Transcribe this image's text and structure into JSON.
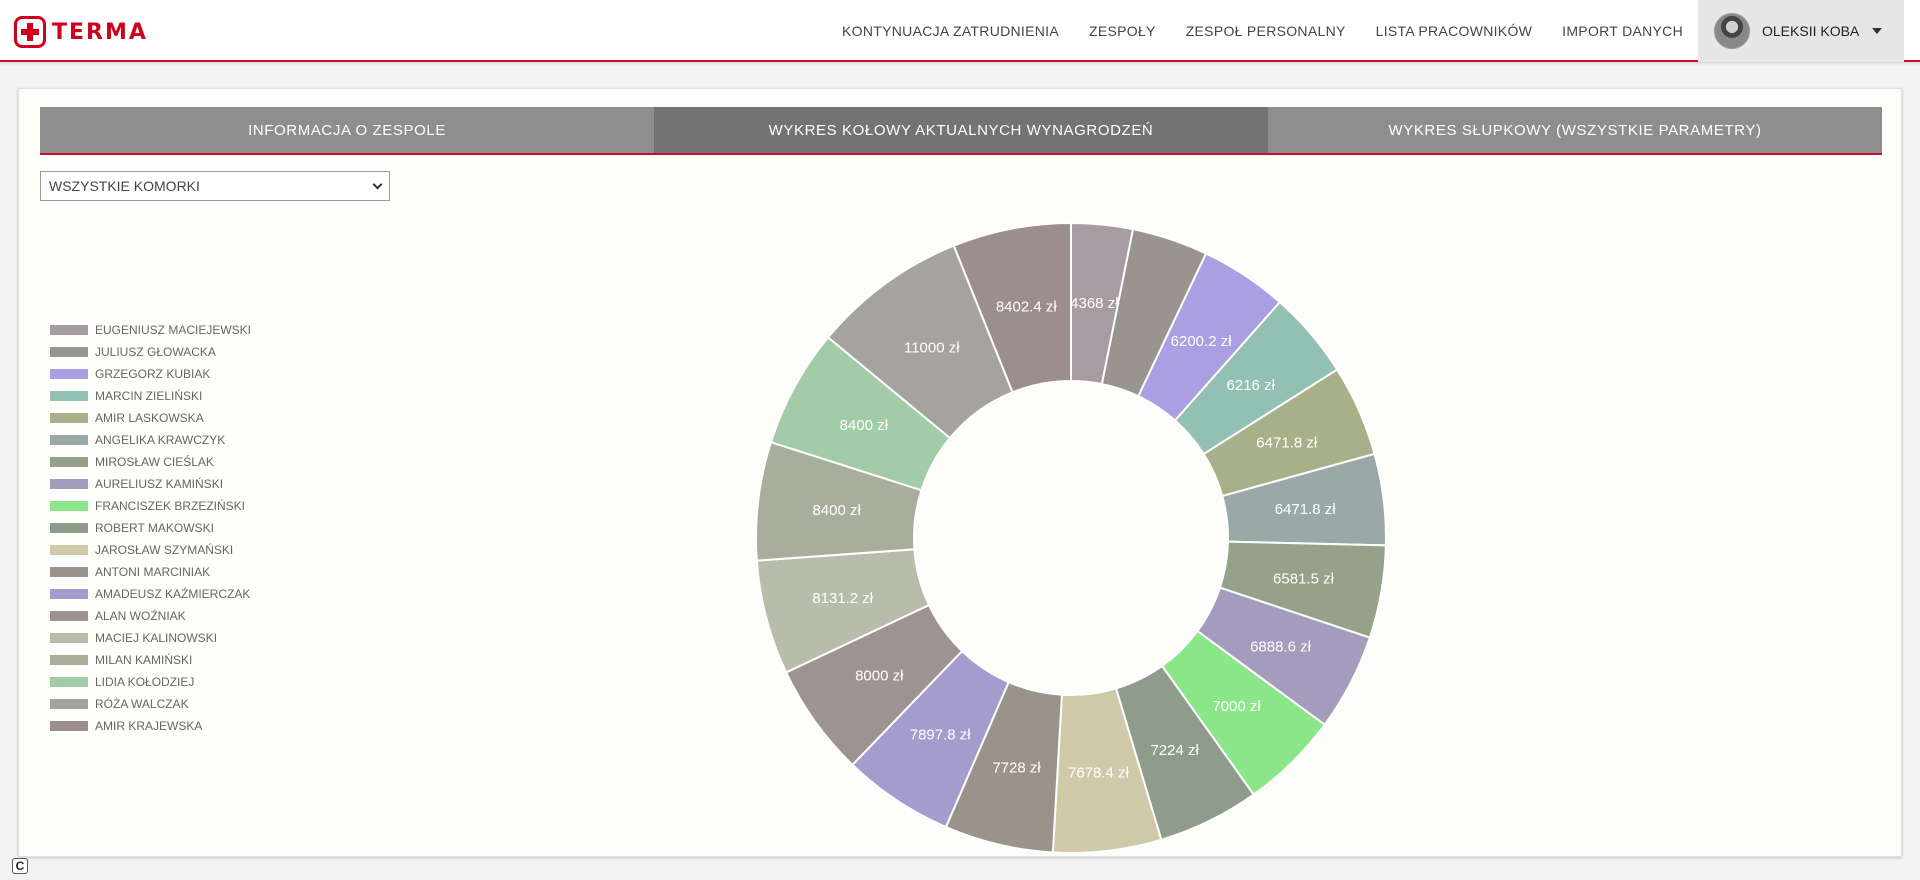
{
  "app": {
    "logo_text": "TERMA"
  },
  "nav": {
    "items": [
      "KONTYNUACJA ZATRUDNIENIA",
      "ZESPOŁY",
      "ZESPOŁ PERSONALNY",
      "LISTA PRACOWNIKÓW",
      "IMPORT DANYCH"
    ]
  },
  "user": {
    "name": "OLEKSII KOBA"
  },
  "tabs": [
    {
      "label": "INFORMACJA O ZESPOLE",
      "active": false
    },
    {
      "label": "WYKRES KOŁOWY AKTUALNYCH WYNAGRODZEŃ",
      "active": true
    },
    {
      "label": "WYKRES SŁUPKOWY (WSZYSTKIE PARAMETRY)",
      "active": false
    }
  ],
  "filter": {
    "selected": "WSZYSTKIE KOMORKI"
  },
  "chart_data": {
    "type": "pie",
    "donut": true,
    "unit": "zł",
    "legend_position": "left",
    "slices": [
      {
        "name": "EUGENIUSZ MACIEJEWSKI",
        "value": 4368,
        "label": "4368 zł",
        "color": "#a89ca3"
      },
      {
        "name": "JULIUSZ GŁOWACKA",
        "value": 5400,
        "label": "",
        "color": "#9a948f"
      },
      {
        "name": "GRZEGORZ KUBIAK",
        "value": 6200.2,
        "label": "6200.2 zł",
        "color": "#ab9fe3"
      },
      {
        "name": "MARCIN ZIELIŃSKI",
        "value": 6216,
        "label": "6216 zł",
        "color": "#92c0b3"
      },
      {
        "name": "AMIR LASKOWSKA",
        "value": 6471.8,
        "label": "6471.8 zł",
        "color": "#a8b08a"
      },
      {
        "name": "ANGELIKA KRAWCZYK",
        "value": 6471.8,
        "label": "6471.8 zł",
        "color": "#9aa8a8"
      },
      {
        "name": "MIROSŁAW CIEŚLAK",
        "value": 6581.5,
        "label": "6581.5 zł",
        "color": "#95a289"
      },
      {
        "name": "AURELIUSZ KAMIŃSKI",
        "value": 6888.6,
        "label": "6888.6 zł",
        "color": "#a59bbd"
      },
      {
        "name": "FRANCISZEK BRZEZIŃSKI",
        "value": 7000,
        "label": "7000 zł",
        "color": "#8be68a"
      },
      {
        "name": "ROBERT MAKOWSKI",
        "value": 7224,
        "label": "7224 zł",
        "color": "#8f9c8c"
      },
      {
        "name": "JAROSŁAW SZYMAŃSKI",
        "value": 7678.4,
        "label": "7678.4 zł",
        "color": "#cfc8a9"
      },
      {
        "name": "ANTONI MARCINIAK",
        "value": 7728,
        "label": "7728 zł",
        "color": "#9a938b"
      },
      {
        "name": "AMADEUSZ KAŹMIERCZAK",
        "value": 7897.8,
        "label": "7897.8 zł",
        "color": "#a39ccd"
      },
      {
        "name": "ALAN WOŹNIAK",
        "value": 8000,
        "label": "8000 zł",
        "color": "#9c9392"
      },
      {
        "name": "MACIEJ KALINOWSKI",
        "value": 8131.2,
        "label": "8131.2 zł",
        "color": "#b7bdaa"
      },
      {
        "name": "MILAN KAMIŃSKI",
        "value": 8400,
        "label": "8400 zł",
        "color": "#a8ae9b"
      },
      {
        "name": "LIDIA KOŁODZIEJ",
        "value": 8400,
        "label": "8400 zł",
        "color": "#a2cba7"
      },
      {
        "name": "RÓŻA WALCZAK",
        "value": 11000,
        "label": "11000 zł",
        "color": "#a6a39e"
      },
      {
        "name": "AMIR KRAJEWSKA",
        "value": 8402.4,
        "label": "8402.4 zł",
        "color": "#9c8d8e"
      }
    ]
  }
}
